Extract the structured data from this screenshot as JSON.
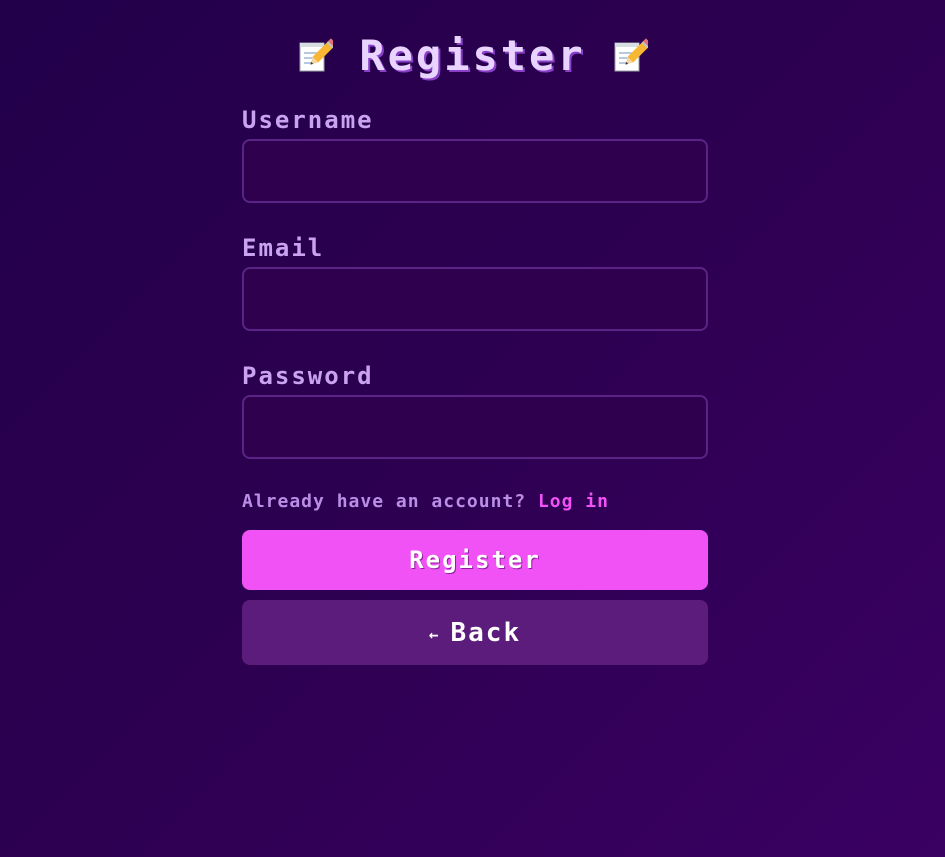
{
  "header": {
    "title": "Register",
    "left_icon": "memo-pencil-icon",
    "right_icon": "memo-pencil-icon"
  },
  "form": {
    "username": {
      "label": "Username",
      "value": "",
      "placeholder": ""
    },
    "email": {
      "label": "Email",
      "value": "",
      "placeholder": ""
    },
    "password": {
      "label": "Password",
      "value": "",
      "placeholder": ""
    }
  },
  "login_prompt": {
    "text": "Already have an account? ",
    "link_label": "Log in"
  },
  "buttons": {
    "register_label": "Register",
    "back_arrow": "←",
    "back_label": "Back"
  },
  "colors": {
    "background": "#2c0050",
    "accent": "#f052f5",
    "secondary_button": "#5c1c7c",
    "input_background": "#2e004d",
    "input_border": "#5a2487",
    "label": "#c9a3f0"
  }
}
